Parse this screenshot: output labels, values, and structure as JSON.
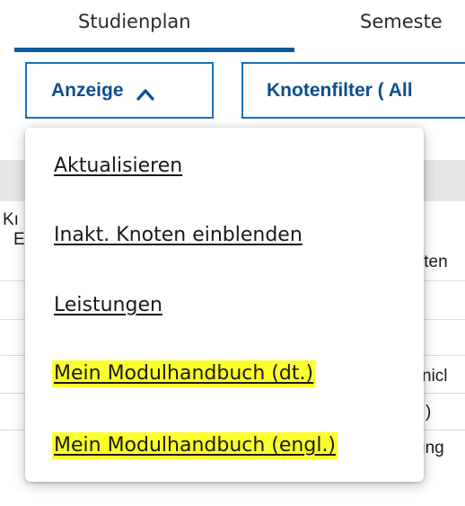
{
  "tabs": {
    "studienplan": "Studienplan",
    "semester": "Semeste"
  },
  "toolbar": {
    "anzeige_label": "Anzeige",
    "knotenfilter_label": "Knotenfilter ( All"
  },
  "background_fragments": {
    "k_line": "Kı",
    "e_line": "E",
    "aften": "ften",
    "nicl": "nicl",
    "paren": ")",
    "ung": "ung"
  },
  "menu": {
    "items": [
      {
        "label": "Aktualisieren",
        "highlighted": false
      },
      {
        "label": "Inakt. Knoten einblenden",
        "highlighted": false
      },
      {
        "label": "Leistungen",
        "highlighted": false
      },
      {
        "label": "Mein Modulhandbuch (dt.)",
        "highlighted": true
      },
      {
        "label": "Mein Modulhandbuch (engl.)",
        "highlighted": true
      }
    ]
  },
  "colors": {
    "accent": "#0e5a9c",
    "button_border": "#1d6fb8",
    "button_text": "#0e4f8e",
    "highlight": "#fbff2a"
  },
  "icons": {
    "anzeige_chevron": "chevron-up-icon"
  }
}
